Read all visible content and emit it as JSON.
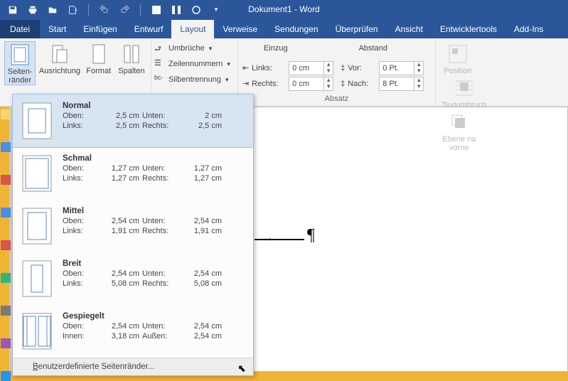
{
  "title": "Dokument1 - Word",
  "tabs": {
    "datei": "Datei",
    "start": "Start",
    "einfuegen": "Einfügen",
    "entwurf": "Entwurf",
    "layout": "Layout",
    "verweise": "Verweise",
    "sendungen": "Sendungen",
    "ueberpruefen": "Überprüfen",
    "ansicht": "Ansicht",
    "entwicklertools": "Entwicklertools",
    "addins": "Add-Ins"
  },
  "ribbon": {
    "seitenraender": "Seiten-\nränder",
    "ausrichtung": "Ausrichtung",
    "format": "Format",
    "spalten": "Spalten",
    "umbrueche": "Umbrüche",
    "zeilennummern": "Zeilennummern",
    "silbentrennung": "Silbentrennung",
    "einzug": "Einzug",
    "abstand": "Abstand",
    "links": "Links:",
    "rechts": "Rechts:",
    "vor": "Vor:",
    "nach": "Nach:",
    "val_links": "0 cm",
    "val_rechts": "0 cm",
    "val_vor": "0 Pt.",
    "val_nach": "8 Pt.",
    "absatz": "Absatz",
    "position": "Position",
    "textumbruch": "Textumbruch",
    "ebene": "Ebene na\nvorne"
  },
  "dropdown": {
    "options": [
      {
        "name": "Normal",
        "l1": "Oben:",
        "v1": "2,5 cm",
        "l2": "Unten:",
        "v2": "2 cm",
        "l3": "Links:",
        "v3": "2,5 cm",
        "l4": "Rechts:",
        "v4": "2,5 cm"
      },
      {
        "name": "Schmal",
        "l1": "Oben:",
        "v1": "1,27 cm",
        "l2": "Unten:",
        "v2": "1,27 cm",
        "l3": "Links:",
        "v3": "1,27 cm",
        "l4": "Rechts:",
        "v4": "1,27 cm"
      },
      {
        "name": "Mittel",
        "l1": "Oben:",
        "v1": "2,54 cm",
        "l2": "Unten:",
        "v2": "2,54 cm",
        "l3": "Links:",
        "v3": "1,91 cm",
        "l4": "Rechts:",
        "v4": "1,91 cm"
      },
      {
        "name": "Breit",
        "l1": "Oben:",
        "v1": "2,54 cm",
        "l2": "Unten:",
        "v2": "2,54 cm",
        "l3": "Links:",
        "v3": "5,08 cm",
        "l4": "Rechts:",
        "v4": "5,08 cm"
      },
      {
        "name": "Gespiegelt",
        "l1": "Oben:",
        "v1": "2,54 cm",
        "l2": "Unten:",
        "v2": "2,54 cm",
        "l3": "Innen:",
        "v3": "3,18 cm",
        "l4": "Außen:",
        "v4": "2,54 cm"
      }
    ],
    "custom": "Benutzerdefinierte Seitenränder..."
  }
}
